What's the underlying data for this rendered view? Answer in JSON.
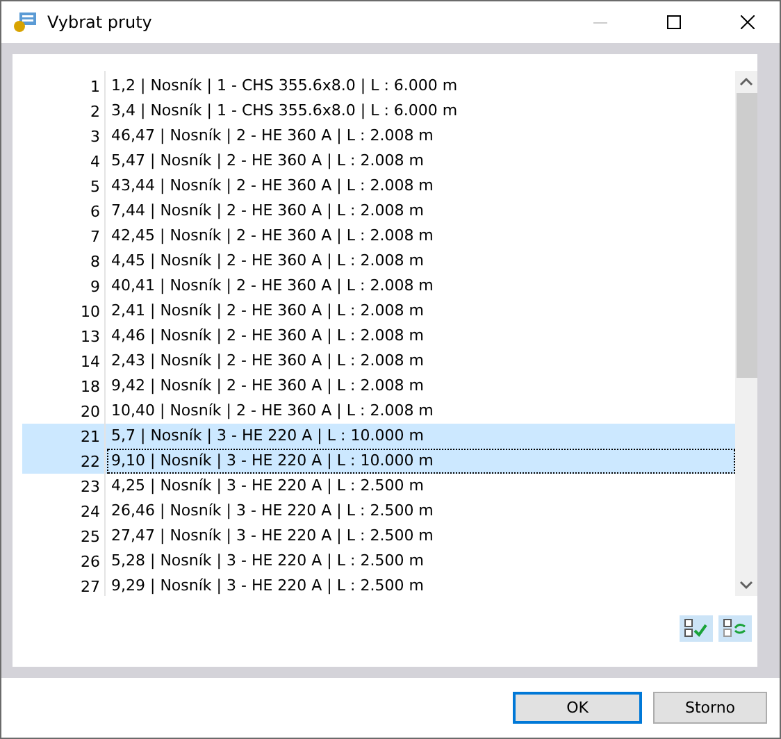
{
  "window": {
    "title": "Vybrat pruty"
  },
  "rows": [
    {
      "number": "1",
      "text": "1,2 | Nosník | 1 - CHS 355.6x8.0 | L : 6.000 m",
      "selected": false,
      "focused": false
    },
    {
      "number": "2",
      "text": "3,4 | Nosník | 1 - CHS 355.6x8.0 | L : 6.000 m",
      "selected": false,
      "focused": false
    },
    {
      "number": "3",
      "text": "46,47 | Nosník | 2 - HE 360 A | L : 2.008 m",
      "selected": false,
      "focused": false
    },
    {
      "number": "4",
      "text": "5,47 | Nosník | 2 - HE 360 A | L : 2.008 m",
      "selected": false,
      "focused": false
    },
    {
      "number": "5",
      "text": "43,44 | Nosník | 2 - HE 360 A | L : 2.008 m",
      "selected": false,
      "focused": false
    },
    {
      "number": "6",
      "text": "7,44 | Nosník | 2 - HE 360 A | L : 2.008 m",
      "selected": false,
      "focused": false
    },
    {
      "number": "7",
      "text": "42,45 | Nosník | 2 - HE 360 A | L : 2.008 m",
      "selected": false,
      "focused": false
    },
    {
      "number": "8",
      "text": "4,45 | Nosník | 2 - HE 360 A | L : 2.008 m",
      "selected": false,
      "focused": false
    },
    {
      "number": "9",
      "text": "40,41 | Nosník | 2 - HE 360 A | L : 2.008 m",
      "selected": false,
      "focused": false
    },
    {
      "number": "10",
      "text": "2,41 | Nosník | 2 - HE 360 A | L : 2.008 m",
      "selected": false,
      "focused": false
    },
    {
      "number": "13",
      "text": "4,46 | Nosník | 2 - HE 360 A | L : 2.008 m",
      "selected": false,
      "focused": false
    },
    {
      "number": "14",
      "text": "2,43 | Nosník | 2 - HE 360 A | L : 2.008 m",
      "selected": false,
      "focused": false
    },
    {
      "number": "18",
      "text": "9,42 | Nosník | 2 - HE 360 A | L : 2.008 m",
      "selected": false,
      "focused": false
    },
    {
      "number": "20",
      "text": "10,40 | Nosník | 2 - HE 360 A | L : 2.008 m",
      "selected": false,
      "focused": false
    },
    {
      "number": "21",
      "text": "5,7 | Nosník | 3 - HE 220 A | L : 10.000 m",
      "selected": true,
      "focused": false
    },
    {
      "number": "22",
      "text": "9,10 | Nosník | 3 - HE 220 A | L : 10.000 m",
      "selected": true,
      "focused": true
    },
    {
      "number": "23",
      "text": "4,25 | Nosník | 3 - HE 220 A | L : 2.500 m",
      "selected": false,
      "focused": false
    },
    {
      "number": "24",
      "text": "26,46 | Nosník | 3 - HE 220 A | L : 2.500 m",
      "selected": false,
      "focused": false
    },
    {
      "number": "25",
      "text": "27,47 | Nosník | 3 - HE 220 A | L : 2.500 m",
      "selected": false,
      "focused": false
    },
    {
      "number": "26",
      "text": "5,28 | Nosník | 3 - HE 220 A | L : 2.500 m",
      "selected": false,
      "focused": false
    },
    {
      "number": "27",
      "text": "9,29 | Nosník | 3 - HE 220 A | L : 2.500 m",
      "selected": false,
      "focused": false
    }
  ],
  "buttons": [
    {
      "label": "OK",
      "default": true
    },
    {
      "label": "Storno",
      "default": false
    }
  ]
}
